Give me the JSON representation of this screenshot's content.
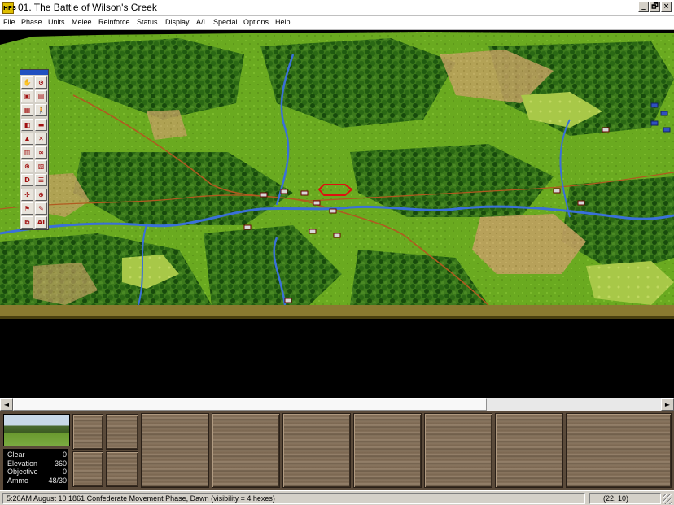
{
  "window": {
    "title": "01. The Battle of Wilson's Creek",
    "icon": "app-icon",
    "icon_text": "HPS",
    "controls": {
      "minimize": "_",
      "restore": "🗗",
      "close": "×"
    }
  },
  "menu": [
    "File",
    "Phase",
    "Units",
    "Melee",
    "Reinforce",
    "Status",
    "Display",
    "A/I",
    "Special",
    "Options",
    "Help"
  ],
  "palette": {
    "tools": [
      {
        "name": "move-tool-icon",
        "glyph": "✋"
      },
      {
        "name": "look-tool-icon",
        "glyph": "⊙"
      },
      {
        "name": "unit-stack-icon",
        "glyph": "▣"
      },
      {
        "name": "next-unit-icon",
        "glyph": "▤"
      },
      {
        "name": "unit-info-icon",
        "glyph": "▦"
      },
      {
        "name": "soldier-icon",
        "glyph": "🚶"
      },
      {
        "name": "toggle-map-icon",
        "glyph": "◧"
      },
      {
        "name": "terrain-icon",
        "glyph": "▬"
      },
      {
        "name": "hierarchy-icon",
        "glyph": "▲"
      },
      {
        "name": "artillery-icon",
        "glyph": "✕"
      },
      {
        "name": "formation-icon",
        "glyph": "▥"
      },
      {
        "name": "binoculars-icon",
        "glyph": "∞"
      },
      {
        "name": "fire-icon",
        "glyph": "⊛"
      },
      {
        "name": "melee-icon",
        "glyph": "▧"
      },
      {
        "name": "defend-icon",
        "glyph": "D"
      },
      {
        "name": "unit-list-icon",
        "glyph": "☰"
      },
      {
        "name": "compass-icon",
        "glyph": "✣"
      },
      {
        "name": "target-icon",
        "glyph": "⊕"
      },
      {
        "name": "flag-icon",
        "glyph": "⚑"
      },
      {
        "name": "reinforce-icon",
        "glyph": "✎"
      },
      {
        "name": "stack-icon",
        "glyph": "⧉"
      },
      {
        "name": "ai-icon",
        "glyph": "AI"
      }
    ]
  },
  "terrain_info": {
    "rows": [
      {
        "label": "Clear",
        "value": "0"
      },
      {
        "label": "Elevation",
        "value": "360"
      },
      {
        "label": "Objective",
        "value": "0"
      },
      {
        "label": "Ammo",
        "value": "48/30"
      }
    ]
  },
  "status": {
    "message": "5:20AM August 10 1861 Confederate Movement Phase, Dawn (visibility = 4 hexes)",
    "coords": "(22, 10)"
  },
  "scrollbar": {
    "left_arrow": "◄",
    "right_arrow": "►"
  },
  "colors": {
    "grass": "#6aaa20",
    "forest": "#2e6a14",
    "field": "#b89858",
    "river": "#3a70d8",
    "road": "#b05a20"
  }
}
